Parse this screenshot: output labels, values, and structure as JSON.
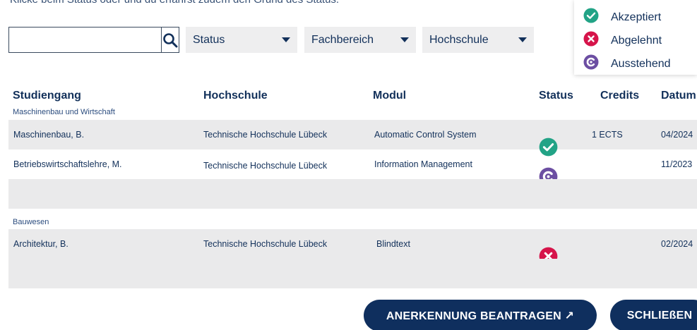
{
  "hint_text": "Klicke beim Status oder und du erfährst zudem den Grund des Status.",
  "search": {
    "placeholder": "",
    "value": ""
  },
  "filters": {
    "status": "Status",
    "fachbereich": "Fachbereich",
    "hochschule": "Hochschule"
  },
  "legend": [
    {
      "label": "Akzeptiert",
      "status": "accepted"
    },
    {
      "label": "Abgelehnt",
      "status": "rejected"
    },
    {
      "label": "Ausstehend",
      "status": "pending"
    }
  ],
  "colors": {
    "accepted": "#22a386",
    "rejected": "#d6144a",
    "pending": "#6c4ea2",
    "primary": "#0f2f5e",
    "row_bg": "#eaeaeb"
  },
  "table": {
    "headers": {
      "studiengang": "Studiengang",
      "hochschule": "Hochschule",
      "modul": "Modul",
      "status": "Status",
      "credits": "Credits",
      "datum": "Datum"
    },
    "groups": [
      {
        "label": "Maschinenbau und Wirtschaft",
        "rows": [
          {
            "studiengang": "Maschinenbau, B.",
            "hochschule": "Technische Hochschule Lübeck",
            "modul": "Automatic Control System",
            "status": "accepted",
            "credits": "1 ECTS",
            "datum": "04/2024"
          },
          {
            "studiengang": "Betriebswirtschaftslehre, M.",
            "hochschule": "Technische Hochschule Lübeck",
            "modul": "Information Management",
            "status": "pending",
            "credits": "",
            "datum": "11/2023"
          }
        ]
      },
      {
        "label": "Bauwesen",
        "rows": [
          {
            "studiengang": "Architektur, B.",
            "hochschule": "Technische Hochschule Lübeck",
            "modul": "Blindtext",
            "status": "rejected",
            "credits": "",
            "datum": "02/2024"
          }
        ]
      }
    ]
  },
  "buttons": {
    "apply": "ANERKENNUNG BEANTRAGEN ↗",
    "close": "SCHLIEßEN"
  }
}
